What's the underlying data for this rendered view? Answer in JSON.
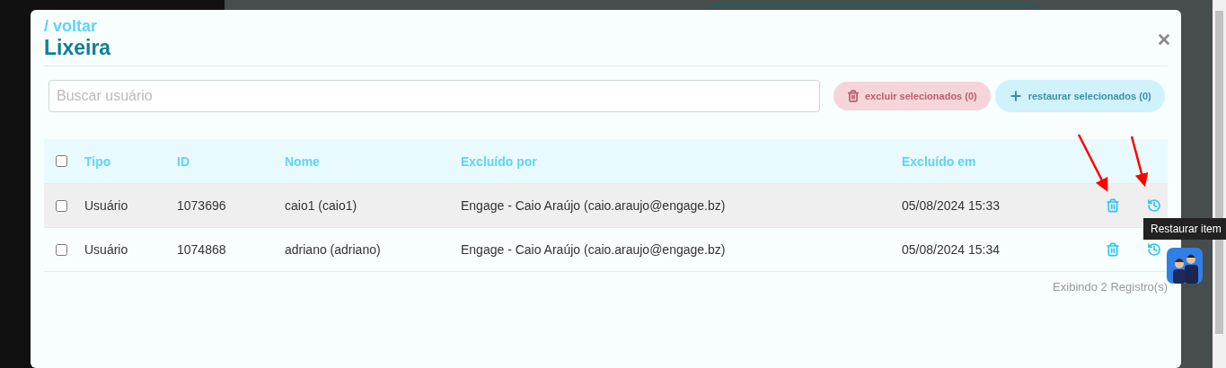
{
  "modal": {
    "back_link": "/ voltar",
    "title": "Lixeira"
  },
  "search": {
    "placeholder": "Buscar usuário"
  },
  "actions": [
    {
      "kind": "delete",
      "label": "excluir selecionados (0)",
      "disabled": true
    },
    {
      "kind": "restore",
      "label": "restaurar selecionados (0)",
      "disabled": true
    }
  ],
  "table": {
    "select_all": {
      "checked": false
    },
    "columns": [
      "Tipo",
      "ID",
      "Nome",
      "Excluído por",
      "Excluído em"
    ],
    "rows": [
      {
        "checked": false,
        "hovered": true,
        "cells": [
          "Usuário",
          "1073696",
          "caio1 (caio1)",
          "Engage - Caio Araújo (caio.araujo@engage.bz)",
          "05/08/2024 15:33"
        ]
      },
      {
        "checked": false,
        "hovered": false,
        "cells": [
          "Usuário",
          "1074868",
          "adriano (adriano)",
          "Engage - Caio Araújo (caio.araujo@engage.bz)",
          "05/08/2024 15:34"
        ]
      }
    ]
  },
  "footer": "Exibindo 2 Registro(s)",
  "tooltip": "Restaurar item"
}
